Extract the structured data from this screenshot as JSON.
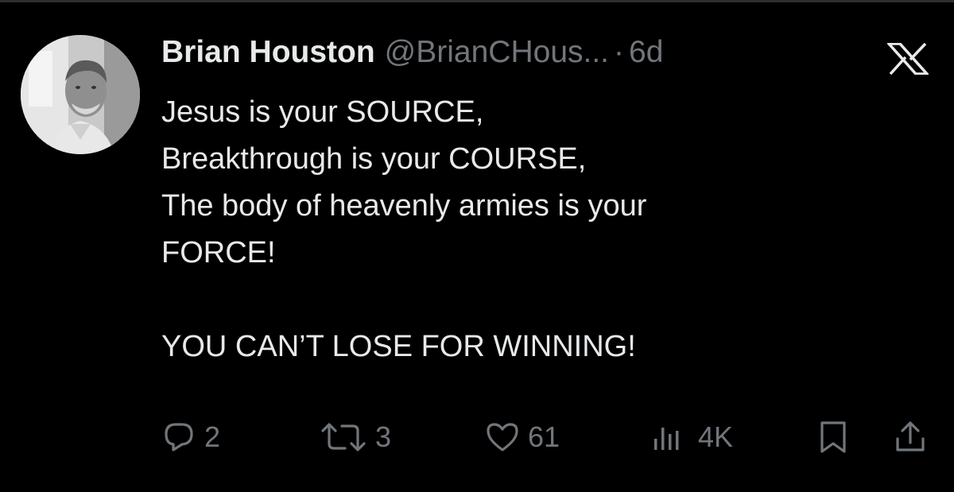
{
  "tweet": {
    "author_name": "Brian Houston",
    "author_handle": "@BrianCHous...",
    "separator": "·",
    "time": "6d",
    "avatar_icon": "profile-photo",
    "platform_icon": "x-logo-icon",
    "text_lines": [
      "Jesus is your SOURCE,",
      "Breakthrough is your COURSE,",
      "The body of heavenly armies is your",
      "FORCE!",
      "",
      "YOU CAN’T LOSE FOR WINNING!"
    ]
  },
  "actions": {
    "reply": {
      "icon": "reply-icon",
      "count": "2"
    },
    "repost": {
      "icon": "repost-icon",
      "count": "3"
    },
    "like": {
      "icon": "heart-icon",
      "count": "61"
    },
    "views": {
      "icon": "views-icon",
      "count": "4K"
    },
    "bookmark": {
      "icon": "bookmark-icon"
    },
    "share": {
      "icon": "share-icon"
    }
  },
  "colors": {
    "background": "#000000",
    "text_primary": "#e7e9ea",
    "text_secondary": "#71767b"
  }
}
